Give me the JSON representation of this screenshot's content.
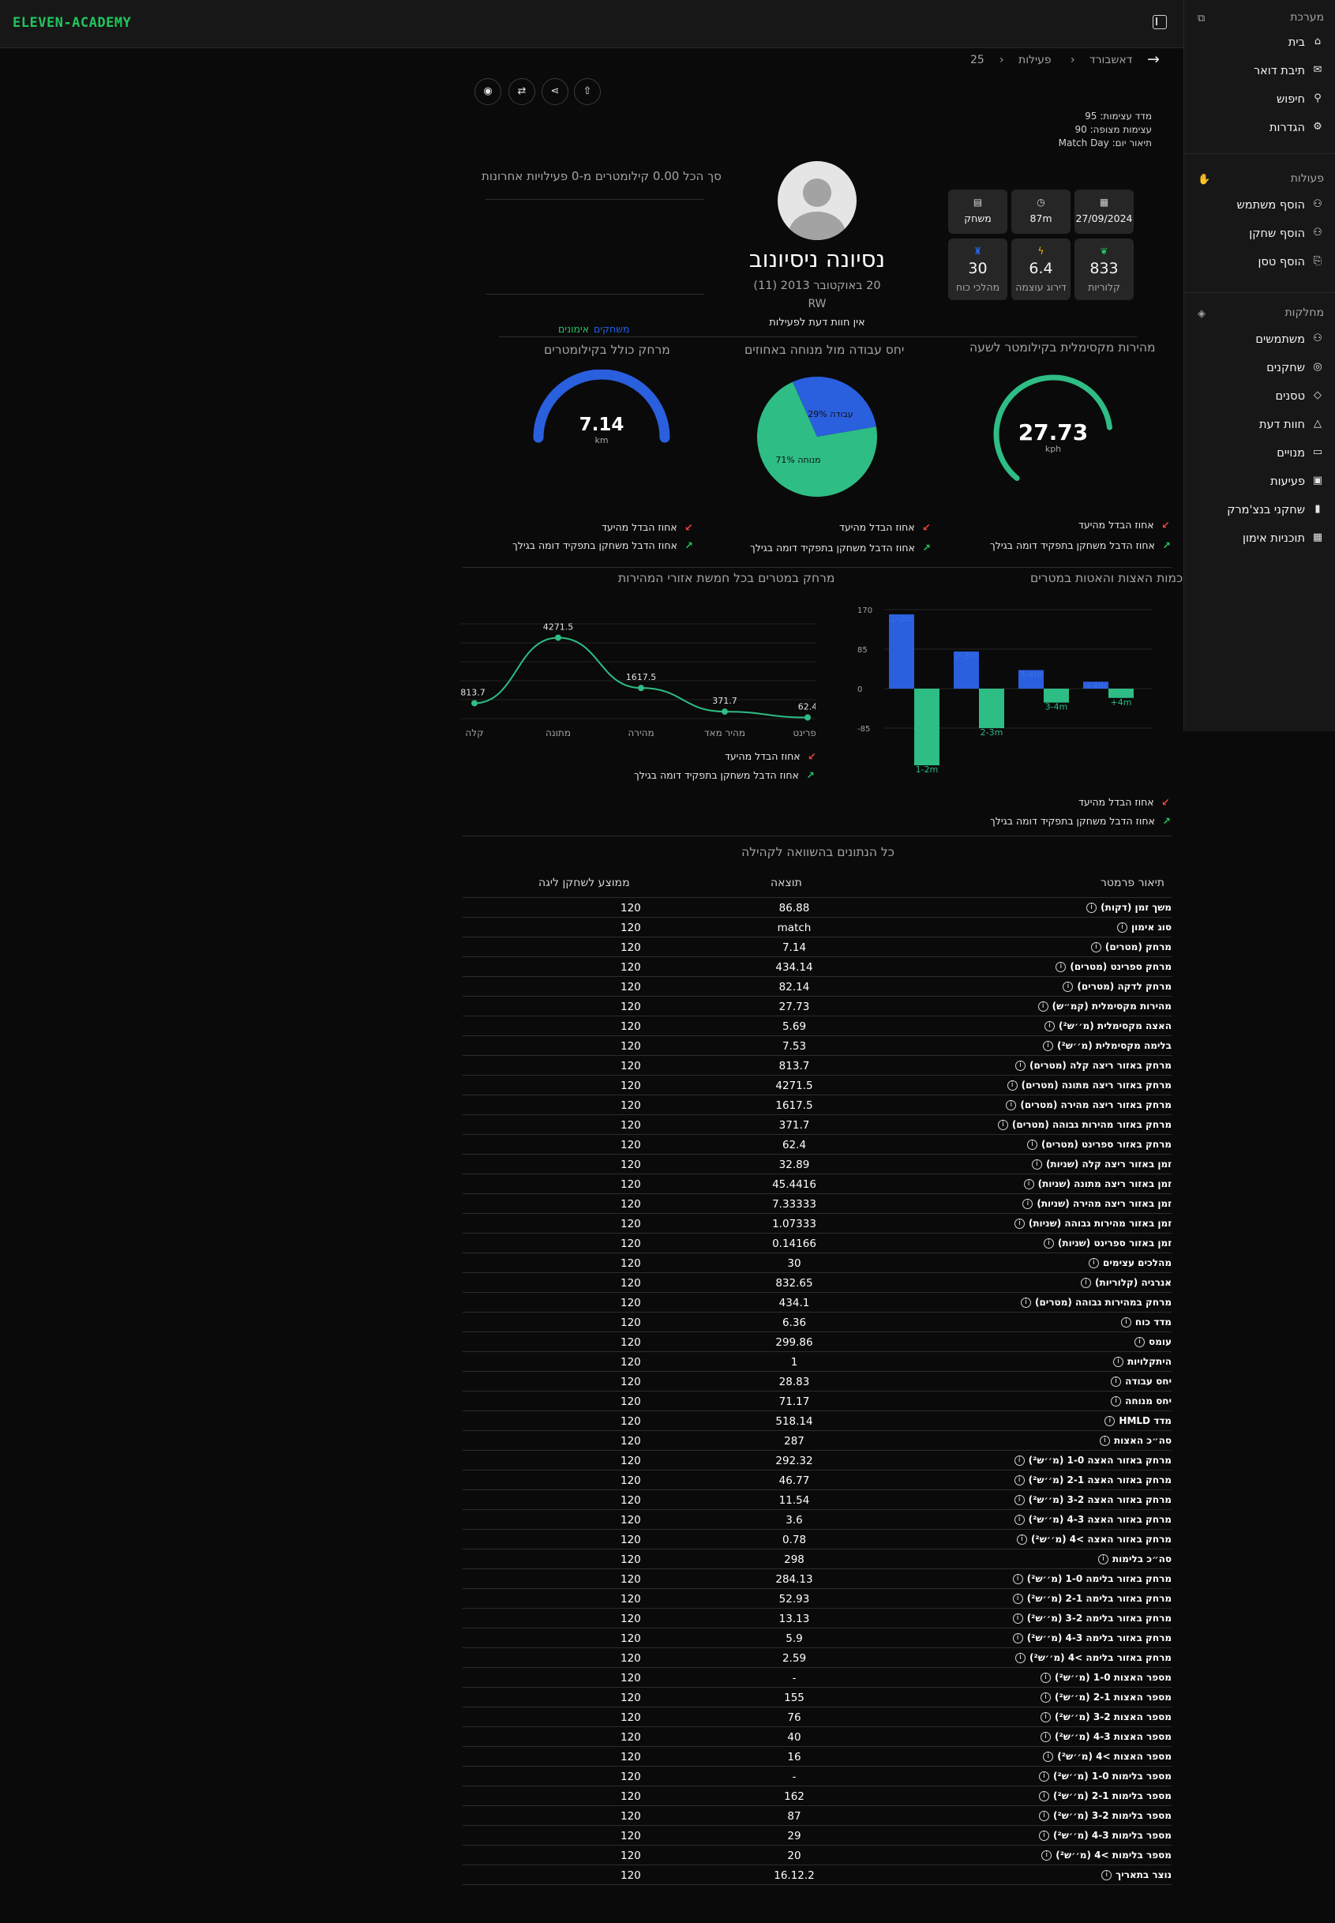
{
  "app": {
    "logo": "ELEVEN-ACADEMY"
  },
  "sidebar": {
    "system_header": "מערכת",
    "system_items": [
      {
        "label": "בית",
        "icon": "home-icon"
      },
      {
        "label": "תיבת דואר",
        "icon": "inbox-icon"
      },
      {
        "label": "חיפוש",
        "icon": "search-icon"
      },
      {
        "label": "הגדרות",
        "icon": "gear-icon"
      }
    ],
    "actions_header": "פעולות",
    "action_items": [
      {
        "label": "הוסף משתמש",
        "icon": "user-plus-icon"
      },
      {
        "label": "הוסף שחקן",
        "icon": "user-plus-icon"
      },
      {
        "label": "הוסף טסן",
        "icon": "file-plus-icon"
      }
    ],
    "departments_header": "מחלקות",
    "department_items": [
      {
        "label": "משתמשים",
        "icon": "users-icon"
      },
      {
        "label": "שחקנים",
        "icon": "user-circle-icon"
      },
      {
        "label": "טסנים",
        "icon": "diamond-icon"
      },
      {
        "label": "חוות דעת",
        "icon": "cone-icon"
      },
      {
        "label": "מנויים",
        "icon": "card-icon"
      },
      {
        "label": "פעיעות",
        "icon": "briefcase-icon"
      },
      {
        "label": "שחקני בנצ'מרק",
        "icon": "bar-chart-icon"
      },
      {
        "label": "תוכניות אימון",
        "icon": "calendar-icon"
      }
    ]
  },
  "breadcrumb": {
    "items": [
      "דאשבורד",
      "פעילות",
      "25"
    ]
  },
  "meta": {
    "intensity": "מדד עצימות: 95",
    "expected": "עצימות מצופה: 90",
    "day_desc": "תיאור יום: Match Day"
  },
  "summary": "סך הכל 0.00 קילומטרים מ-0 פעילויות אחרונות",
  "player": {
    "name": "נסיונה ניסיונוב",
    "birth": "20 באוקטובר 2013 (11)",
    "position": "RW",
    "no_opinion": "אין חוות דעת לפעילות",
    "tab_players": "משחקים",
    "tab_trainings": "אימונים"
  },
  "cards": [
    {
      "value": "27/09/2024",
      "label": "",
      "icon": "calendar-icon",
      "icon_color": "#d4d4d4"
    },
    {
      "value": "87m",
      "label": "",
      "icon": "stopwatch-icon",
      "icon_color": "#d4d4d4"
    },
    {
      "value": "משחק",
      "label": "",
      "icon": "document-icon",
      "icon_color": "#d4d4d4"
    },
    {
      "value": "833",
      "label": "קלוריות",
      "icon": "leaf-icon",
      "icon_color": "#22c55e"
    },
    {
      "value": "6.4",
      "label": "דירוג עוצמה",
      "icon": "bolt-icon",
      "icon_color": "#eab308"
    },
    {
      "value": "30",
      "label": "מהלכי כוח",
      "icon": "trophy-icon",
      "icon_color": "#2563eb"
    }
  ],
  "gauges": {
    "speed": {
      "title": "מהירות מקסימלית בקילומטר לשעה",
      "value": "27.73",
      "unit": "kph",
      "fraction": 0.73,
      "color": "#2ebd85"
    },
    "ratio": {
      "title": "יחס עבודה מול מנוחה באחוזים",
      "work_label": "29% עבודה",
      "rest_label": "71% מנוחה",
      "work_pct": 29,
      "rest_pct": 71,
      "work_color": "#2a5fde",
      "rest_color": "#2ebd85"
    },
    "distance": {
      "title": "מרחק כולל בקילומטרים",
      "value": "7.14",
      "unit": "km",
      "fraction": 1.0,
      "color": "#2a5fde"
    }
  },
  "legend": {
    "red": "אחוז הבדל מהיעד",
    "green": "אחוז הדבל משחקן בתפקיד דומה בגילך"
  },
  "chart_data": [
    {
      "type": "bar",
      "title": "כמות האצות והאטות במטרים",
      "categories": [
        "1-2m",
        "2-3m",
        "3-4m",
        "+4m"
      ],
      "series": [
        {
          "values": [
            160,
            80,
            40,
            15
          ],
          "color": "#2a5fde"
        },
        {
          "values": [
            -165,
            -85,
            -30,
            -20
          ],
          "color": "#2ebd85"
        }
      ],
      "yticks": [
        "170",
        "85",
        "0",
        "-85"
      ],
      "ylim": [
        -170,
        170
      ]
    },
    {
      "type": "line",
      "title": "מרחק במטרים בכל חמשת אזורי המהירות",
      "categories": [
        "קלה",
        "מתונה",
        "מהירה",
        "מהיר מאד",
        "ספרינט"
      ],
      "values": [
        813.7,
        4271.5,
        1617.5,
        371.7,
        62.4
      ],
      "labels": [
        "813.7",
        "4271.5",
        "1617.5",
        "371.7",
        "62.4"
      ],
      "color": "#2ebd85"
    }
  ],
  "table": {
    "title": "כל הנתונים בהשוואה לקהילה",
    "headers": {
      "param": "תיאור פרמטר",
      "result": "תוצאה",
      "avg": "ממוצע לשחקן ליגה"
    },
    "rows": [
      [
        "משך זמן (דקות)",
        "86.88",
        "120"
      ],
      [
        "סוג אימון",
        "match",
        "120"
      ],
      [
        "מרחק (מטרים)",
        "7.14",
        "120"
      ],
      [
        "מרחק ספרינט (מטרים)",
        "434.14",
        "120"
      ],
      [
        "מרחק לדקה (מטרים)",
        "82.14",
        "120"
      ],
      [
        "מהירות מקסימלית (קמ״ש)",
        "27.73",
        "120"
      ],
      [
        "האצה מקסימלית (מ׳׳ש²)",
        "5.69",
        "120"
      ],
      [
        "בלימה מקסימלית (מ׳׳ש²)",
        "7.53",
        "120"
      ],
      [
        "מרחק באזור ריצה קלה (מטרים)",
        "813.7",
        "120"
      ],
      [
        "מרחק באזור ריצה מתונה (מטרים)",
        "4271.5",
        "120"
      ],
      [
        "מרחק באזור ריצה מהירה (מטרים)",
        "1617.5",
        "120"
      ],
      [
        "מרחק באזור מהירות גבוהה (מטרים)",
        "371.7",
        "120"
      ],
      [
        "מרחק באזור ספרינט (מטרים)",
        "62.4",
        "120"
      ],
      [
        "זמן באזור ריצה קלה (שניות)",
        "32.89",
        "120"
      ],
      [
        "זמן באזור ריצה מתונה (שניות)",
        "45.4416",
        "120"
      ],
      [
        "זמן באזור ריצה מהירה (שניות)",
        "7.33333",
        "120"
      ],
      [
        "זמן באזור מהירות גבוהה (שניות)",
        "1.07333",
        "120"
      ],
      [
        "זמן באזור ספרינט (שניות)",
        "0.14166",
        "120"
      ],
      [
        "מהלכים עצימים",
        "30",
        "120"
      ],
      [
        "אנרגיה (קלוריות)",
        "832.65",
        "120"
      ],
      [
        "מרחק במהירות גבוהה (מטרים)",
        "434.1",
        "120"
      ],
      [
        "מדד כוח",
        "6.36",
        "120"
      ],
      [
        "עומס",
        "299.86",
        "120"
      ],
      [
        "היתקלויות",
        "1",
        "120"
      ],
      [
        "יחס עבודה",
        "28.83",
        "120"
      ],
      [
        "יחס מנוחה",
        "71.17",
        "120"
      ],
      [
        "מדד HMLD",
        "518.14",
        "120"
      ],
      [
        "סה״כ האצות",
        "287",
        "120"
      ],
      [
        "מרחק באזור האצה 1-0 (מ׳׳ש²)",
        "292.32",
        "120"
      ],
      [
        "מרחק באזור האצה 2-1 (מ׳׳ש²)",
        "46.77",
        "120"
      ],
      [
        "מרחק באזור האצה 3-2 (מ׳׳ש²)",
        "11.54",
        "120"
      ],
      [
        "מרחק באזור האצה 4-3 (מ׳׳ש²)",
        "3.6",
        "120"
      ],
      [
        "מרחק באזור האצה >4 (מ׳׳ש²)",
        "0.78",
        "120"
      ],
      [
        "סה״כ בלימות",
        "298",
        "120"
      ],
      [
        "מרחק באזור בלימה 1-0 (מ׳׳ש²)",
        "284.13",
        "120"
      ],
      [
        "מרחק באזור בלימה 2-1 (מ׳׳ש²)",
        "52.93",
        "120"
      ],
      [
        "מרחק באזור בלימה 3-2 (מ׳׳ש²)",
        "13.13",
        "120"
      ],
      [
        "מרחק באזור בלימה 4-3 (מ׳׳ש²)",
        "5.9",
        "120"
      ],
      [
        "מרחק באזור בלימה >4 (מ׳׳ש²)",
        "2.59",
        "120"
      ],
      [
        "מספר האצות 1-0 (מ׳׳ש²)",
        "-",
        "120"
      ],
      [
        "מספר האצות 2-1 (מ׳׳ש²)",
        "155",
        "120"
      ],
      [
        "מספר האצות 3-2 (מ׳׳ש²)",
        "76",
        "120"
      ],
      [
        "מספר האצות 4-3 (מ׳׳ש²)",
        "40",
        "120"
      ],
      [
        "מספר האצות >4 (מ׳׳ש²)",
        "16",
        "120"
      ],
      [
        "מספר בלימות 1-0 (מ׳׳ש²)",
        "-",
        "120"
      ],
      [
        "מספר בלימות 2-1 (מ׳׳ש²)",
        "162",
        "120"
      ],
      [
        "מספר בלימות 3-2 (מ׳׳ש²)",
        "87",
        "120"
      ],
      [
        "מספר בלימות 4-3 (מ׳׳ש²)",
        "29",
        "120"
      ],
      [
        "מספר בלימות >4 (מ׳׳ש²)",
        "20",
        "120"
      ],
      [
        "נוצר בתאריך",
        "16.12.2",
        "120"
      ]
    ]
  }
}
